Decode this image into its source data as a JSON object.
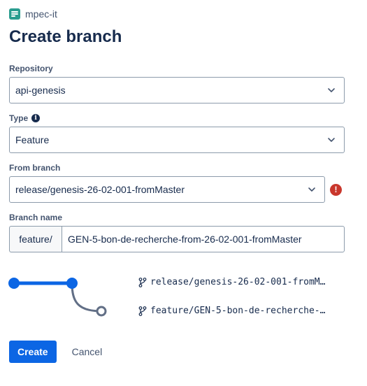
{
  "workspace": {
    "name": "mpec-it",
    "icon": "workspace-logo-icon",
    "color": "#2a9d8f"
  },
  "page_title": "Create branch",
  "form": {
    "repository": {
      "label": "Repository",
      "value": "api-genesis"
    },
    "type": {
      "label": "Type",
      "info_icon": "info-icon",
      "value": "Feature"
    },
    "from_branch": {
      "label": "From branch",
      "value": "release/genesis-26-02-001-fromMaster",
      "status_icon": "error-icon",
      "status_color": "#c9372c"
    },
    "branch_name": {
      "label": "Branch name",
      "prefix": "feature/",
      "value": "GEN-5-bon-de-recherche-from-26-02-001-fromMaster"
    }
  },
  "preview": {
    "source_branch": "release/genesis-26-02-001-fromM…",
    "new_branch": "feature/GEN-5-bon-de-recherche-…",
    "source_color": "#0c66e4",
    "new_color": "#626f86"
  },
  "actions": {
    "create_label": "Create",
    "cancel_label": "Cancel",
    "primary_color": "#0c66e4"
  }
}
